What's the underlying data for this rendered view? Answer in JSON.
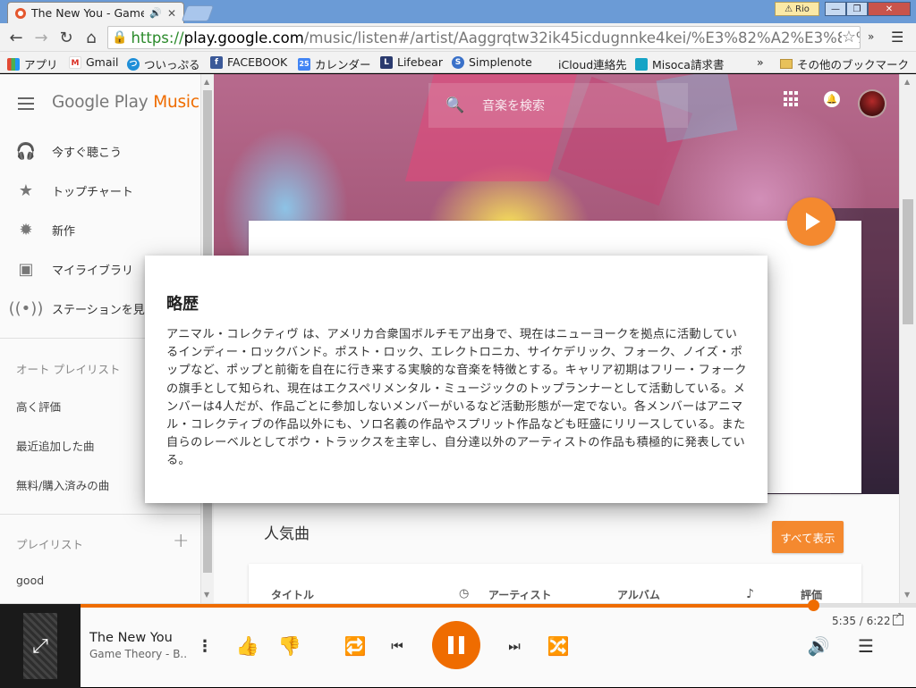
{
  "browser": {
    "tab_title": "The New You - Game",
    "tab_close": "✕",
    "user_label": "Rio",
    "win_min": "—",
    "win_max": "❐",
    "win_close": "✕",
    "url_scheme": "https://",
    "url_host": "play.google.com",
    "url_path": "/music/listen#/artist/Aaggrqtw32ik45icdugnnke4kei/%E3%82%A2%E3%83%9",
    "ext_more": "»",
    "bookmarks": [
      {
        "label": "アプリ",
        "icon": "apps-icon",
        "color": "#e24a33"
      },
      {
        "label": "Gmail",
        "icon": "gmail-icon",
        "color": "#d93025"
      },
      {
        "label": "ついっぷる",
        "icon": "twipple-icon",
        "color": "#1f8fd8"
      },
      {
        "label": "FACEBOOK",
        "icon": "facebook-icon",
        "color": "#3b5998"
      },
      {
        "label": "カレンダー",
        "icon": "calendar-icon",
        "color": "#4285f4"
      },
      {
        "label": "Lifebear",
        "icon": "lifebear-icon",
        "color": "#2a3a6e"
      },
      {
        "label": "Simplenote",
        "icon": "simplenote-icon",
        "color": "#3a71c9"
      },
      {
        "label": "iCloud連絡先",
        "icon": "apple-icon",
        "color": "#333333"
      },
      {
        "label": "Misoca請求書",
        "icon": "misoca-icon",
        "color": "#16a4c6"
      }
    ],
    "bookmarks_more": "»",
    "other_bookmarks": "その他のブックマーク",
    "calendar_day": "25"
  },
  "sidebar": {
    "logo_prefix": "Google Play ",
    "logo_music": "Music",
    "nav": [
      {
        "label": "今すぐ聴こう",
        "icon": "headphones-icon"
      },
      {
        "label": "トップチャート",
        "icon": "star-icon"
      },
      {
        "label": "新作",
        "icon": "new-release-icon"
      },
      {
        "label": "マイライブラリ",
        "icon": "library-icon"
      },
      {
        "label": "ステーションを見",
        "icon": "radio-icon"
      }
    ],
    "auto_playlists_header": "オート プレイリスト",
    "auto_playlists": [
      "高く評価",
      "最近追加した曲",
      "無料/購入済みの曲"
    ],
    "playlists_header": "プレイリスト",
    "playlists": [
      "good"
    ]
  },
  "header": {
    "search_placeholder": "音楽を検索"
  },
  "artist": {
    "popular_title": "人気曲",
    "show_all": "すべて表示",
    "columns": [
      "タイトル",
      "アーティスト",
      "アルバム",
      "評価"
    ]
  },
  "bio": {
    "title": "略歴",
    "text": "アニマル・コレクティヴ は、アメリカ合衆国ボルチモア出身で、現在はニューヨークを拠点に活動しているインディー・ロックバンド。ポスト・ロック、エレクトロニカ、サイケデリック、フォーク、ノイズ・ポップなど、ポップと前衛を自在に行き来する実験的な音楽を特徴とする。キャリア初期はフリー・フォークの旗手として知られ、現在はエクスペリメンタル・ミュージックのトップランナーとして活動している。メンバーは4人だが、作品ごとに参加しないメンバーがいるなど活動形態が一定でない。各メンバーはアニマル・コレクティブの作品以外にも、ソロ名義の作品やスプリット作品なども旺盛にリリースしている。また自らのレーベルとしてポウ・トラックスを主宰し、自分達以外のアーティストの作品も積極的に発表している。"
  },
  "player": {
    "song_title": "The New You",
    "song_artist": "Game Theory - B...",
    "time": "5:35 / 6:22",
    "progress_fraction": 0.877,
    "accent": "#ef6c00"
  }
}
